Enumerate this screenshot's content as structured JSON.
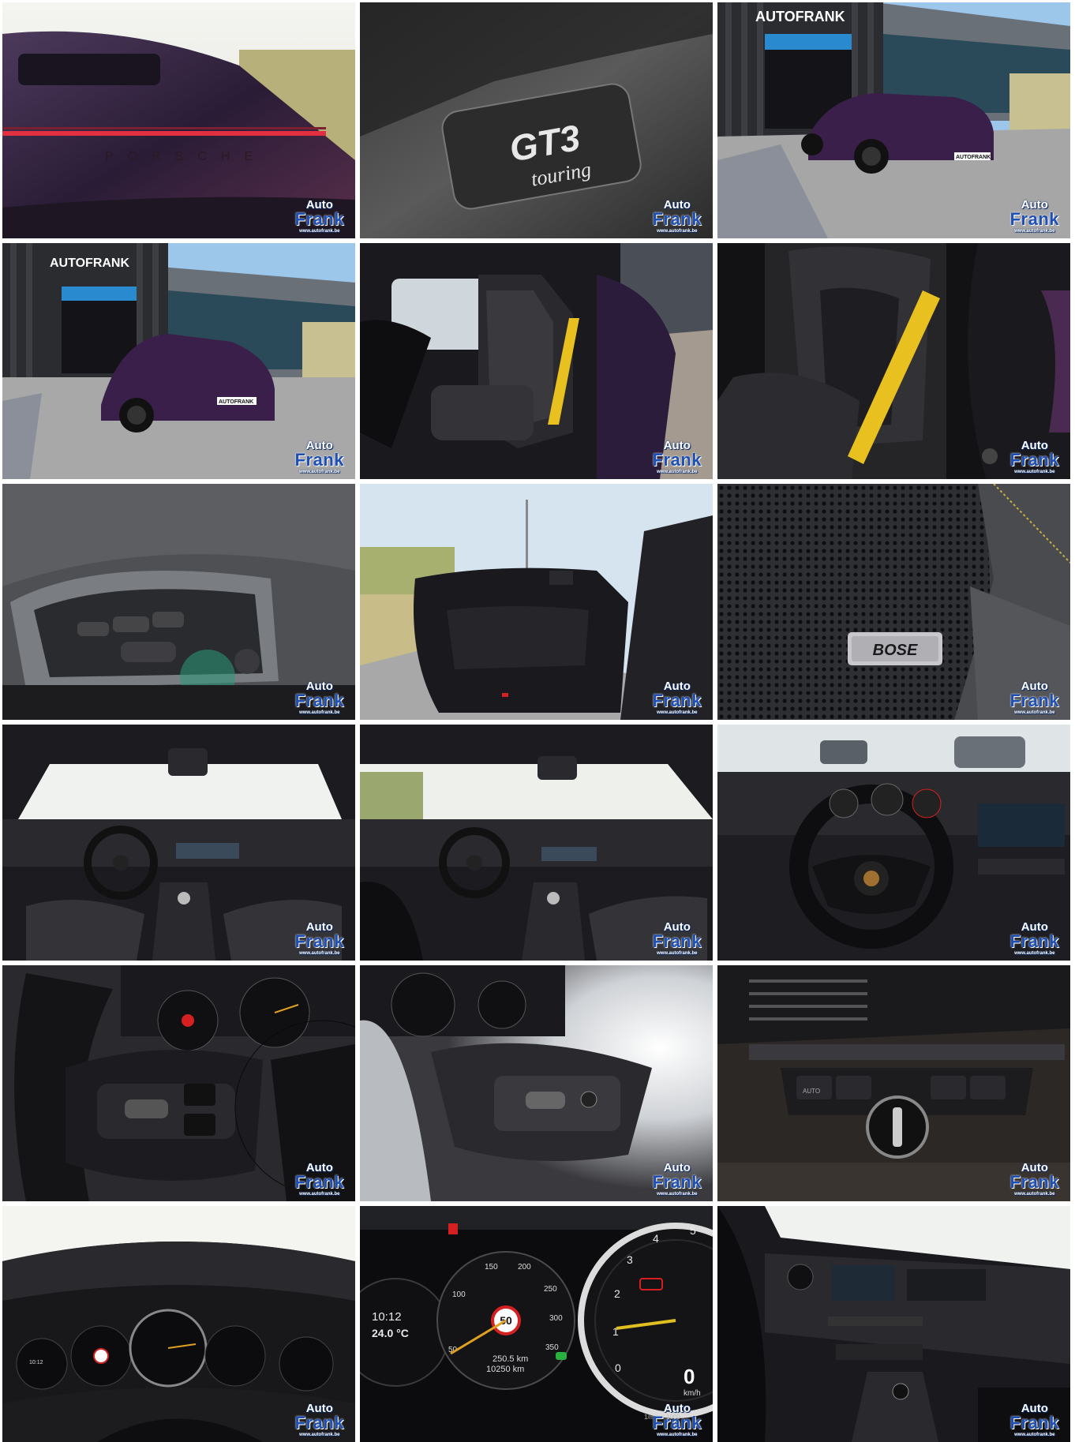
{
  "watermark": {
    "line1": "Auto",
    "line2": "Frank",
    "url": "www.autofrank.be"
  },
  "texts": {
    "rear_badge": "PORSCHE",
    "badge_gt3": "GT3",
    "badge_touring": "touring",
    "dealer_sign": "AUTOFRANK",
    "plate": "AUTOFRANK",
    "speaker_brand": "BOSE",
    "clock_time": "10:12",
    "clock_temp": "24.0 °C",
    "speed_limit": "50",
    "odo_trip": "250.5 km",
    "odo_total": "10250 km",
    "speed_now": "0",
    "speed_unit": "km/h",
    "rpm_unit": "1/min x 1000",
    "switch_auto": "AUTO"
  },
  "speedo_ticks": [
    "50",
    "100",
    "150",
    "200",
    "250",
    "300",
    "350"
  ],
  "rpm_ticks": [
    "0",
    "1",
    "2",
    "3",
    "4",
    "5"
  ],
  "colors": {
    "paint": "#3a1f4a",
    "belt": "#e8c020",
    "accent_red": "#d42020",
    "watermark_blue": "#1e4fb4"
  }
}
